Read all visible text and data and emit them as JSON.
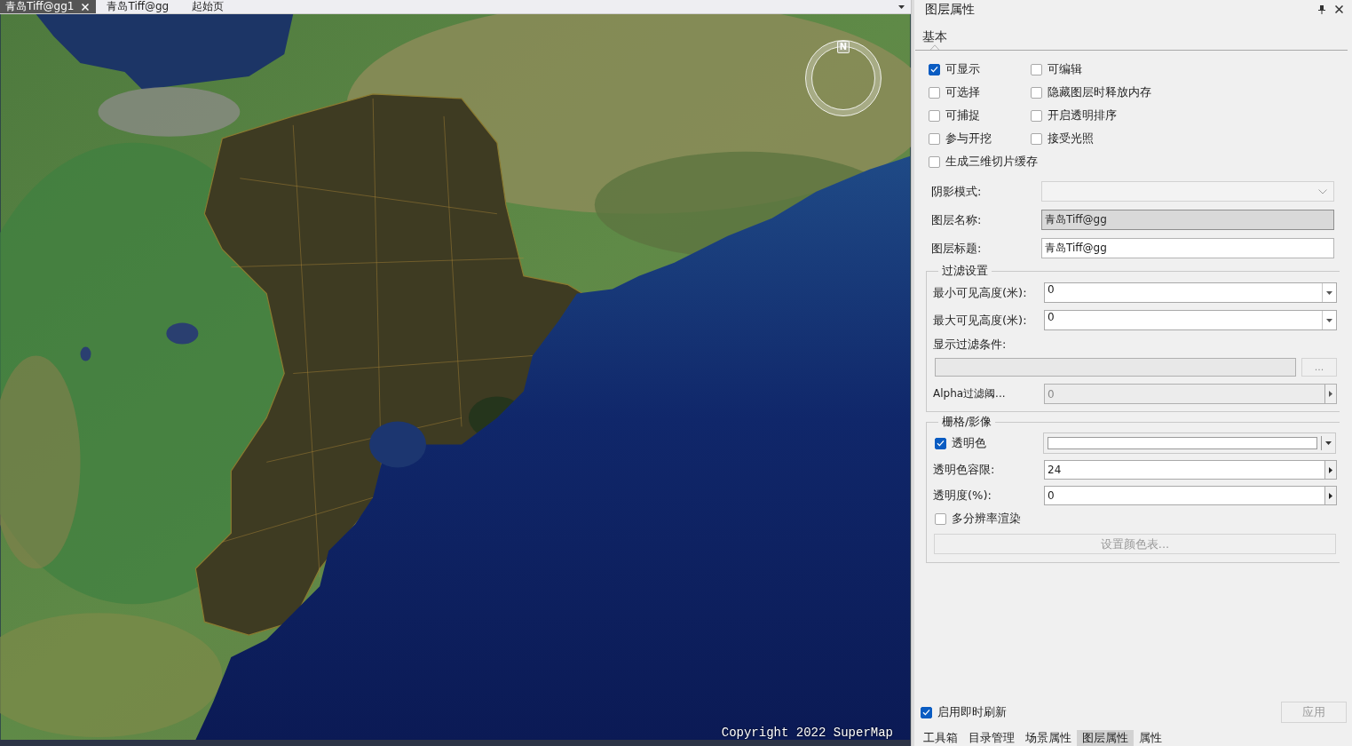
{
  "document_tabs": [
    {
      "label": "青岛Tiff@gg1",
      "selected": true,
      "closable": true
    },
    {
      "label": "青岛Tiff@gg",
      "selected": false,
      "closable": false
    },
    {
      "label": "起始页",
      "selected": false,
      "closable": false
    }
  ],
  "scene": {
    "compass_label": "N",
    "copyright": "Copyright 2022 SuperMap"
  },
  "panel": {
    "title": "图层属性",
    "tabs": [
      {
        "label": "基本",
        "selected": true
      }
    ],
    "checkboxes": [
      {
        "label": "可显示",
        "checked": true
      },
      {
        "label": "可编辑",
        "checked": false
      },
      {
        "label": "可选择",
        "checked": false
      },
      {
        "label": "隐藏图层时释放内存",
        "checked": false
      },
      {
        "label": "可捕捉",
        "checked": false
      },
      {
        "label": "开启透明排序",
        "checked": false
      },
      {
        "label": "参与开挖",
        "checked": false
      },
      {
        "label": "接受光照",
        "checked": false
      },
      {
        "label": "生成三维切片缓存",
        "checked": false
      }
    ],
    "fields": [
      {
        "kind": "combo",
        "label": "阴影模式:",
        "disabled": true
      },
      {
        "kind": "text",
        "label": "图层名称:",
        "value": "青岛Tiff@gg",
        "disabled": true
      },
      {
        "kind": "text",
        "label": "图层标题:",
        "value": "青岛Tiff@gg",
        "disabled": false
      }
    ],
    "filter_group": {
      "title": "过滤设置",
      "items": [
        {
          "kind": "dropdown",
          "label": "最小可见高度(米):",
          "value": "0",
          "disabled": false
        },
        {
          "kind": "dropdown",
          "label": "最大可见高度(米):",
          "value": "0",
          "disabled": false
        },
        {
          "kind": "expression",
          "label": "显示过滤条件:",
          "button": "...",
          "disabled": true
        },
        {
          "kind": "spin",
          "label": "Alpha过滤阈...",
          "value": "0",
          "disabled": true
        }
      ]
    },
    "raster_group": {
      "title": "栅格/影像",
      "transparent_color": {
        "label": "透明色",
        "checked": true
      },
      "tolerance": {
        "label": "透明色容限:",
        "value": "24",
        "disabled": false
      },
      "opacity": {
        "label": "透明度(%):",
        "value": "0",
        "disabled": false
      },
      "multi_resolution": {
        "label": "多分辨率渲染",
        "checked": false
      },
      "color_table_button": {
        "label": "设置颜色表...",
        "disabled": true
      }
    },
    "auto_refresh": {
      "label": "启用即时刷新",
      "checked": true
    },
    "apply_button": {
      "label": "应用",
      "disabled": true
    }
  },
  "bottom_tabs": [
    {
      "label": "工具箱",
      "selected": false
    },
    {
      "label": "目录管理",
      "selected": false
    },
    {
      "label": "场景属性",
      "selected": false
    },
    {
      "label": "图层属性",
      "selected": true
    },
    {
      "label": "属性",
      "selected": false
    }
  ]
}
